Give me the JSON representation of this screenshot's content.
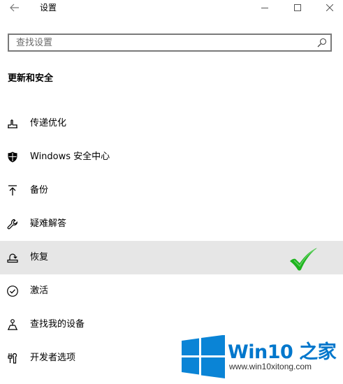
{
  "window": {
    "title": "设置"
  },
  "search": {
    "placeholder": "查找设置",
    "value": ""
  },
  "section": {
    "heading": "更新和安全"
  },
  "nav": {
    "items": [
      {
        "label": "传递优化",
        "icon": "delivery-optimization-icon",
        "selected": false
      },
      {
        "label": "Windows 安全中心",
        "icon": "shield-icon",
        "selected": false
      },
      {
        "label": "备份",
        "icon": "backup-arrow-icon",
        "selected": false
      },
      {
        "label": "疑难解答",
        "icon": "wrench-icon",
        "selected": false
      },
      {
        "label": "恢复",
        "icon": "recovery-icon",
        "selected": true
      },
      {
        "label": "激活",
        "icon": "check-circle-icon",
        "selected": false
      },
      {
        "label": "查找我的设备",
        "icon": "find-device-icon",
        "selected": false
      },
      {
        "label": "开发者选项",
        "icon": "developer-tools-icon",
        "selected": false
      }
    ]
  },
  "watermark": {
    "brand": "Win10 之家",
    "url": "www.win10xitong.com"
  },
  "colors": {
    "accent_green": "#1db31d",
    "selected_bg": "#e6e6e6",
    "logo_blue": "#0a84d6"
  }
}
